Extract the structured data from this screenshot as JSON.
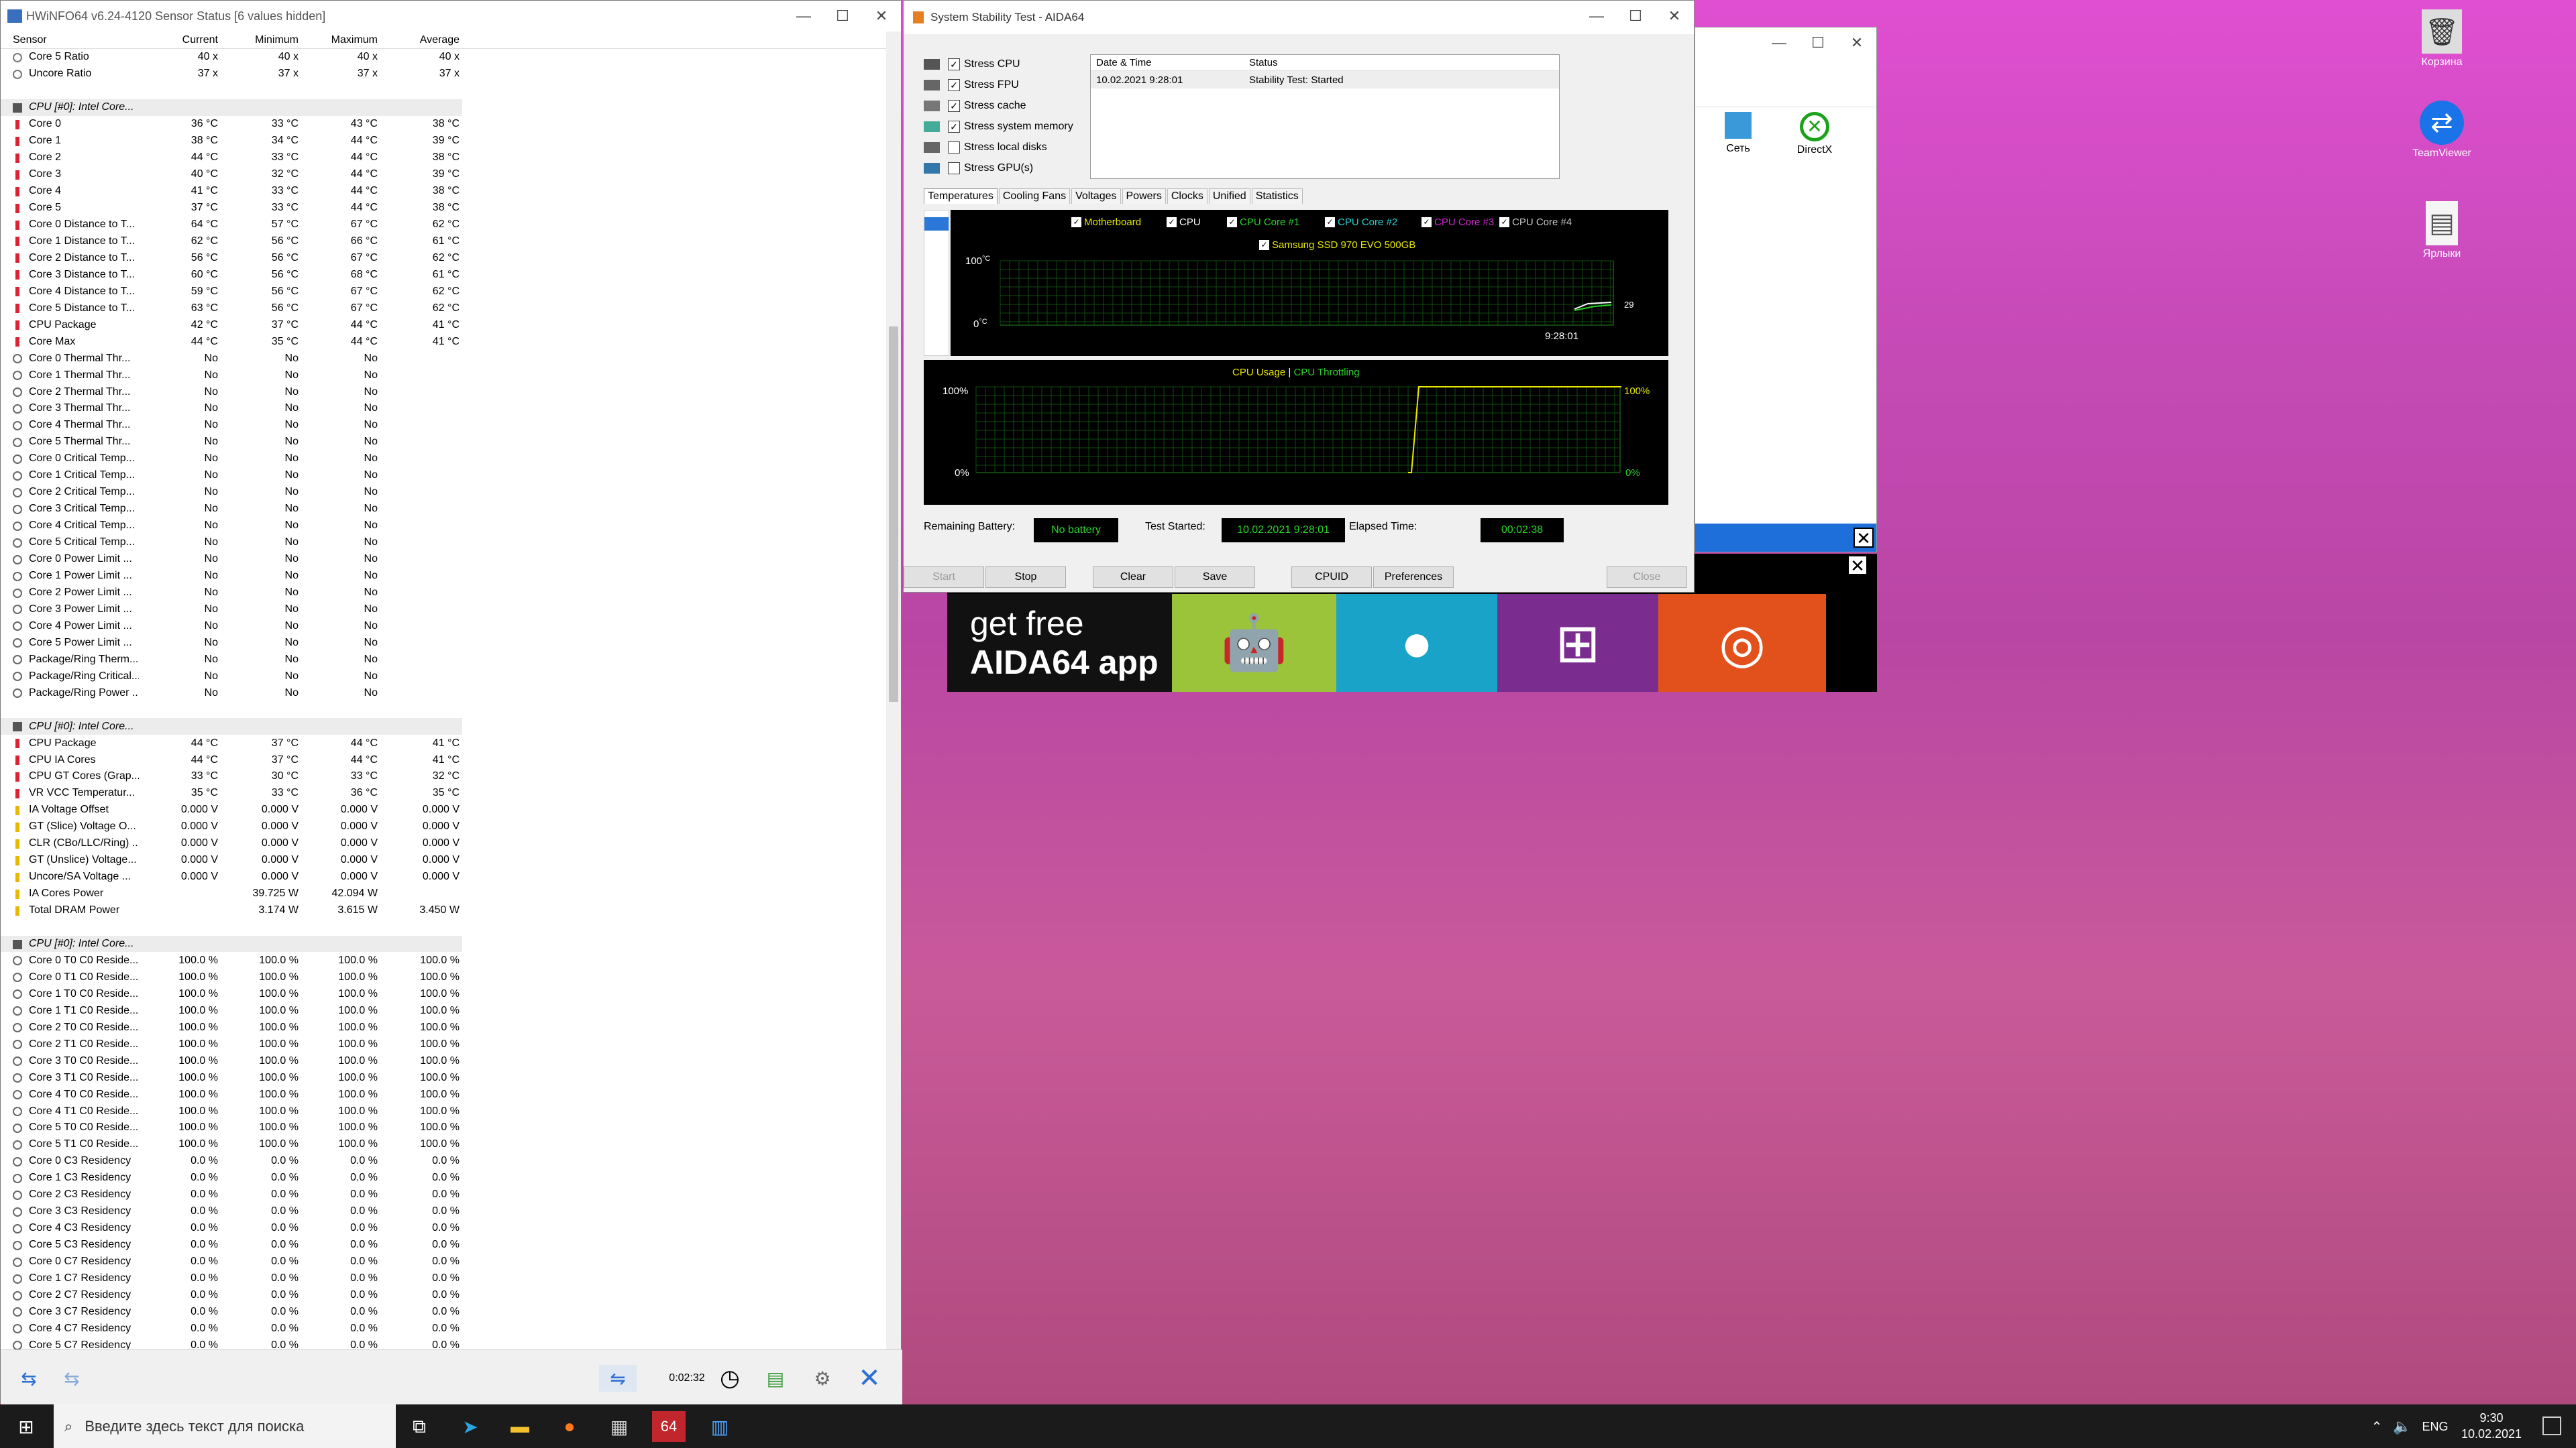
{
  "hwinfo": {
    "title": "HWiNFO64 v6.24-4120 Sensor Status [6 values hidden]",
    "headers": [
      "Sensor",
      "Current",
      "Minimum",
      "Maximum",
      "Average"
    ],
    "rows": [
      [
        "t",
        "Core 5 Ratio",
        "40 x",
        "40 x",
        "40 x",
        "40 x"
      ],
      [
        "t",
        "Uncore Ratio",
        "37 x",
        "37 x",
        "37 x",
        "37 x"
      ],
      [
        "b"
      ],
      [
        "g",
        "CPU [#0]: Intel Core..."
      ],
      [
        "th",
        "Core 0",
        "36 °C",
        "33 °C",
        "43 °C",
        "38 °C"
      ],
      [
        "th",
        "Core 1",
        "38 °C",
        "34 °C",
        "44 °C",
        "39 °C"
      ],
      [
        "th",
        "Core 2",
        "44 °C",
        "33 °C",
        "44 °C",
        "38 °C"
      ],
      [
        "th",
        "Core 3",
        "40 °C",
        "32 °C",
        "44 °C",
        "39 °C"
      ],
      [
        "th",
        "Core 4",
        "41 °C",
        "33 °C",
        "44 °C",
        "38 °C"
      ],
      [
        "th",
        "Core 5",
        "37 °C",
        "33 °C",
        "44 °C",
        "38 °C"
      ],
      [
        "th",
        "Core 0 Distance to T...",
        "64 °C",
        "57 °C",
        "67 °C",
        "62 °C"
      ],
      [
        "th",
        "Core 1 Distance to T...",
        "62 °C",
        "56 °C",
        "66 °C",
        "61 °C"
      ],
      [
        "th",
        "Core 2 Distance to T...",
        "56 °C",
        "56 °C",
        "67 °C",
        "62 °C"
      ],
      [
        "th",
        "Core 3 Distance to T...",
        "60 °C",
        "56 °C",
        "68 °C",
        "61 °C"
      ],
      [
        "th",
        "Core 4 Distance to T...",
        "59 °C",
        "56 °C",
        "67 °C",
        "62 °C"
      ],
      [
        "th",
        "Core 5 Distance to T...",
        "63 °C",
        "56 °C",
        "67 °C",
        "62 °C"
      ],
      [
        "th",
        "CPU Package",
        "42 °C",
        "37 °C",
        "44 °C",
        "41 °C"
      ],
      [
        "th",
        "Core Max",
        "44 °C",
        "35 °C",
        "44 °C",
        "41 °C"
      ],
      [
        "bo",
        "Core 0 Thermal Thr...",
        "No",
        "No",
        "No",
        ""
      ],
      [
        "bo",
        "Core 1 Thermal Thr...",
        "No",
        "No",
        "No",
        ""
      ],
      [
        "bo",
        "Core 2 Thermal Thr...",
        "No",
        "No",
        "No",
        ""
      ],
      [
        "bo",
        "Core 3 Thermal Thr...",
        "No",
        "No",
        "No",
        ""
      ],
      [
        "bo",
        "Core 4 Thermal Thr...",
        "No",
        "No",
        "No",
        ""
      ],
      [
        "bo",
        "Core 5 Thermal Thr...",
        "No",
        "No",
        "No",
        ""
      ],
      [
        "bo",
        "Core 0 Critical Temp...",
        "No",
        "No",
        "No",
        ""
      ],
      [
        "bo",
        "Core 1 Critical Temp...",
        "No",
        "No",
        "No",
        ""
      ],
      [
        "bo",
        "Core 2 Critical Temp...",
        "No",
        "No",
        "No",
        ""
      ],
      [
        "bo",
        "Core 3 Critical Temp...",
        "No",
        "No",
        "No",
        ""
      ],
      [
        "bo",
        "Core 4 Critical Temp...",
        "No",
        "No",
        "No",
        ""
      ],
      [
        "bo",
        "Core 5 Critical Temp...",
        "No",
        "No",
        "No",
        ""
      ],
      [
        "bo",
        "Core 0 Power Limit ...",
        "No",
        "No",
        "No",
        ""
      ],
      [
        "bo",
        "Core 1 Power Limit ...",
        "No",
        "No",
        "No",
        ""
      ],
      [
        "bo",
        "Core 2 Power Limit ...",
        "No",
        "No",
        "No",
        ""
      ],
      [
        "bo",
        "Core 3 Power Limit ...",
        "No",
        "No",
        "No",
        ""
      ],
      [
        "bo",
        "Core 4 Power Limit ...",
        "No",
        "No",
        "No",
        ""
      ],
      [
        "bo",
        "Core 5 Power Limit ...",
        "No",
        "No",
        "No",
        ""
      ],
      [
        "bo",
        "Package/Ring Therm...",
        "No",
        "No",
        "No",
        ""
      ],
      [
        "bo",
        "Package/Ring Critical...",
        "No",
        "No",
        "No",
        ""
      ],
      [
        "bo",
        "Package/Ring Power ...",
        "No",
        "No",
        "No",
        ""
      ],
      [
        "b"
      ],
      [
        "g",
        "CPU [#0]: Intel Core..."
      ],
      [
        "th",
        "CPU Package",
        "44 °C",
        "37 °C",
        "44 °C",
        "41 °C"
      ],
      [
        "th",
        "CPU IA Cores",
        "44 °C",
        "37 °C",
        "44 °C",
        "41 °C"
      ],
      [
        "th",
        "CPU GT Cores (Grap...",
        "33 °C",
        "30 °C",
        "33 °C",
        "32 °C"
      ],
      [
        "th",
        "VR VCC Temperatur...",
        "35 °C",
        "33 °C",
        "36 °C",
        "35 °C"
      ],
      [
        "vl",
        "IA Voltage Offset",
        "0.000 V",
        "0.000 V",
        "0.000 V",
        "0.000 V"
      ],
      [
        "vl",
        "GT (Slice) Voltage O...",
        "0.000 V",
        "0.000 V",
        "0.000 V",
        "0.000 V"
      ],
      [
        "vl",
        "CLR (CBo/LLC/Ring) ...",
        "0.000 V",
        "0.000 V",
        "0.000 V",
        "0.000 V"
      ],
      [
        "vl",
        "GT (Unslice) Voltage...",
        "0.000 V",
        "0.000 V",
        "0.000 V",
        "0.000 V"
      ],
      [
        "vl",
        "Uncore/SA Voltage ...",
        "0.000 V",
        "0.000 V",
        "0.000 V",
        "0.000 V"
      ],
      [
        "vl",
        "IA Cores Power",
        "",
        "39.725 W",
        "42.094 W",
        ""
      ],
      [
        "vl",
        "Total DRAM Power",
        "",
        "3.174 W",
        "3.615 W",
        "3.450 W"
      ],
      [
        "b"
      ],
      [
        "g",
        "CPU [#0]: Intel Core..."
      ],
      [
        "cl",
        "Core 0 T0 C0 Reside...",
        "100.0 %",
        "100.0 %",
        "100.0 %",
        "100.0 %"
      ],
      [
        "cl",
        "Core 0 T1 C0 Reside...",
        "100.0 %",
        "100.0 %",
        "100.0 %",
        "100.0 %"
      ],
      [
        "cl",
        "Core 1 T0 C0 Reside...",
        "100.0 %",
        "100.0 %",
        "100.0 %",
        "100.0 %"
      ],
      [
        "cl",
        "Core 1 T1 C0 Reside...",
        "100.0 %",
        "100.0 %",
        "100.0 %",
        "100.0 %"
      ],
      [
        "cl",
        "Core 2 T0 C0 Reside...",
        "100.0 %",
        "100.0 %",
        "100.0 %",
        "100.0 %"
      ],
      [
        "cl",
        "Core 2 T1 C0 Reside...",
        "100.0 %",
        "100.0 %",
        "100.0 %",
        "100.0 %"
      ],
      [
        "cl",
        "Core 3 T0 C0 Reside...",
        "100.0 %",
        "100.0 %",
        "100.0 %",
        "100.0 %"
      ],
      [
        "cl",
        "Core 3 T1 C0 Reside...",
        "100.0 %",
        "100.0 %",
        "100.0 %",
        "100.0 %"
      ],
      [
        "cl",
        "Core 4 T0 C0 Reside...",
        "100.0 %",
        "100.0 %",
        "100.0 %",
        "100.0 %"
      ],
      [
        "cl",
        "Core 4 T1 C0 Reside...",
        "100.0 %",
        "100.0 %",
        "100.0 %",
        "100.0 %"
      ],
      [
        "cl",
        "Core 5 T0 C0 Reside...",
        "100.0 %",
        "100.0 %",
        "100.0 %",
        "100.0 %"
      ],
      [
        "cl",
        "Core 5 T1 C0 Reside...",
        "100.0 %",
        "100.0 %",
        "100.0 %",
        "100.0 %"
      ],
      [
        "cl",
        "Core 0 C3 Residency",
        "0.0 %",
        "0.0 %",
        "0.0 %",
        "0.0 %"
      ],
      [
        "cl",
        "Core 1 C3 Residency",
        "0.0 %",
        "0.0 %",
        "0.0 %",
        "0.0 %"
      ],
      [
        "cl",
        "Core 2 C3 Residency",
        "0.0 %",
        "0.0 %",
        "0.0 %",
        "0.0 %"
      ],
      [
        "cl",
        "Core 3 C3 Residency",
        "0.0 %",
        "0.0 %",
        "0.0 %",
        "0.0 %"
      ],
      [
        "cl",
        "Core 4 C3 Residency",
        "0.0 %",
        "0.0 %",
        "0.0 %",
        "0.0 %"
      ],
      [
        "cl",
        "Core 5 C3 Residency",
        "0.0 %",
        "0.0 %",
        "0.0 %",
        "0.0 %"
      ],
      [
        "cl",
        "Core 0 C7 Residency",
        "0.0 %",
        "0.0 %",
        "0.0 %",
        "0.0 %"
      ],
      [
        "cl",
        "Core 1 C7 Residency",
        "0.0 %",
        "0.0 %",
        "0.0 %",
        "0.0 %"
      ],
      [
        "cl",
        "Core 2 C7 Residency",
        "0.0 %",
        "0.0 %",
        "0.0 %",
        "0.0 %"
      ],
      [
        "cl",
        "Core 3 C7 Residency",
        "0.0 %",
        "0.0 %",
        "0.0 %",
        "0.0 %"
      ],
      [
        "cl",
        "Core 4 C7 Residency",
        "0.0 %",
        "0.0 %",
        "0.0 %",
        "0.0 %"
      ],
      [
        "cl",
        "Core 5 C7 Residency",
        "0.0 %",
        "0.0 %",
        "0.0 %",
        "0.0 %"
      ]
    ],
    "timer": "0:02:32"
  },
  "aida": {
    "title": "System Stability Test - AIDA64",
    "stress": [
      {
        "label": "Stress CPU",
        "checked": true
      },
      {
        "label": "Stress FPU",
        "checked": true
      },
      {
        "label": "Stress cache",
        "checked": true
      },
      {
        "label": "Stress system memory",
        "checked": true
      },
      {
        "label": "Stress local disks",
        "checked": false
      },
      {
        "label": "Stress GPU(s)",
        "checked": false
      }
    ],
    "status_headers": [
      "Date & Time",
      "Status"
    ],
    "status_row": [
      "10.02.2021 9:28:01",
      "Stability Test: Started"
    ],
    "tabs": [
      "Temperatures",
      "Cooling Fans",
      "Voltages",
      "Powers",
      "Clocks",
      "Unified",
      "Statistics"
    ],
    "legend1": [
      {
        "label": "Motherboard",
        "color": "#e8e800"
      },
      {
        "label": "CPU",
        "color": "#ffffff"
      },
      {
        "label": "CPU Core #1",
        "color": "#29d429"
      },
      {
        "label": "CPU Core #2",
        "color": "#29d4d4"
      },
      {
        "label": "CPU Core #3",
        "color": "#d429d4"
      },
      {
        "label": "CPU Core #4",
        "color": "#c8c8c8"
      },
      {
        "label": "Samsung SSD 970 EVO 500GB",
        "color": "#e8e800"
      }
    ],
    "g1_top": "100",
    "g1_deg": "°C",
    "g1_bot": "0",
    "g1_time": "9:28:01",
    "g1_val": "29",
    "legend2_a": "CPU Usage",
    "legend2_sep": "|",
    "legend2_b": "CPU Throttling",
    "g2_top": "100%",
    "g2_bot": "0%",
    "g2_top_r": "100%",
    "g2_bot_r": "0%",
    "battery_label": "Remaining Battery:",
    "battery": "No battery",
    "started_label": "Test Started:",
    "started": "10.02.2021 9:28:01",
    "elapsed_label": "Elapsed Time:",
    "elapsed": "00:02:38",
    "buttons": [
      "Start",
      "Stop",
      "Clear",
      "Save",
      "CPUID",
      "Preferences",
      "Close"
    ]
  },
  "ad": {
    "line1": "get free",
    "line2": "AIDA64 app"
  },
  "backwin": {
    "icons": [
      "Сеть",
      "DirectX"
    ]
  },
  "desktop": {
    "icons": [
      "Корзина",
      "TeamViewer",
      "Ярлыки"
    ]
  },
  "taskbar": {
    "search": "Введите здесь текст для поиска",
    "lang": "ENG",
    "time": "9:30",
    "date": "10.02.2021"
  }
}
